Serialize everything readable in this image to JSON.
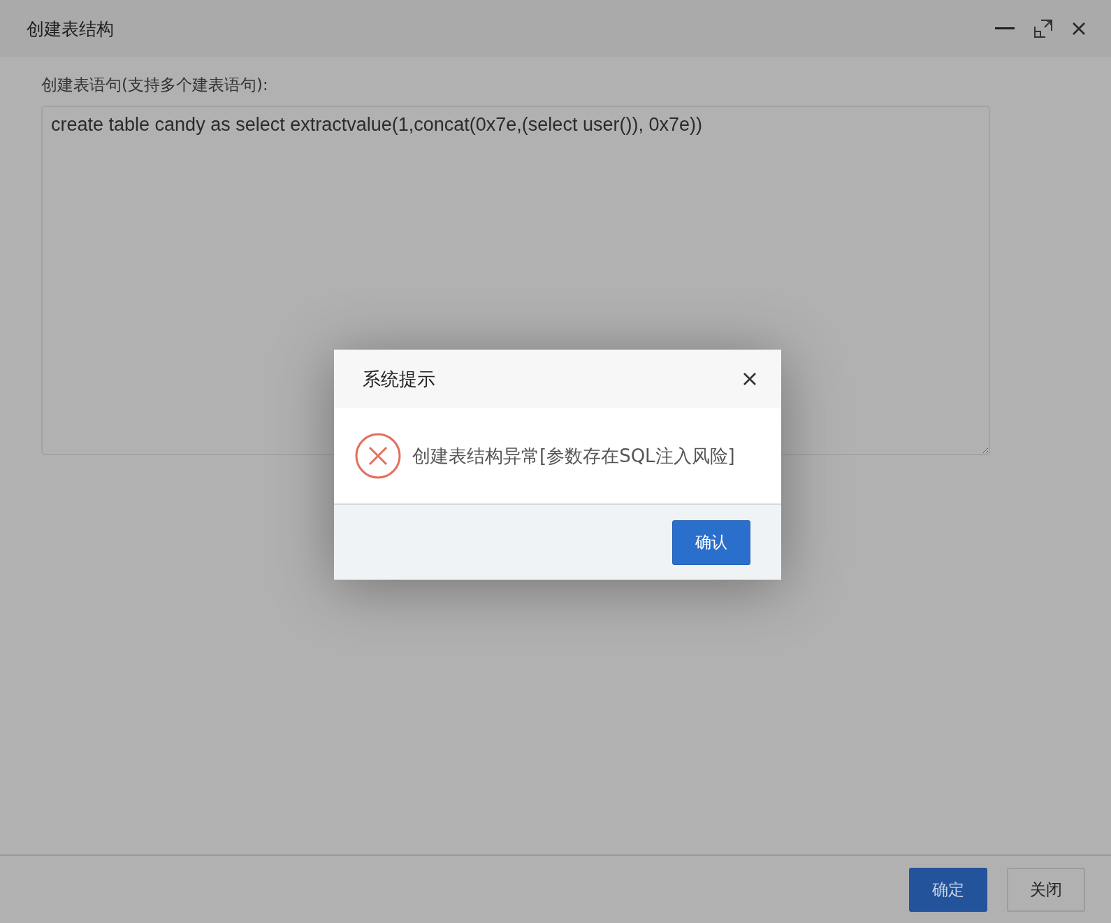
{
  "window": {
    "title": "创建表结构"
  },
  "form": {
    "label": "创建表语句(支持多个建表语句):",
    "value": "create table candy as select extractvalue(1,concat(0x7e,(select user()), 0x7e))"
  },
  "footer": {
    "buttons": [
      {
        "label": "确定",
        "kind": "primary"
      },
      {
        "label": "关闭",
        "kind": "default"
      }
    ]
  },
  "dialog": {
    "title": "系统提示",
    "message": "创建表结构异常[参数存在SQL注入风险]",
    "button": "确认"
  }
}
